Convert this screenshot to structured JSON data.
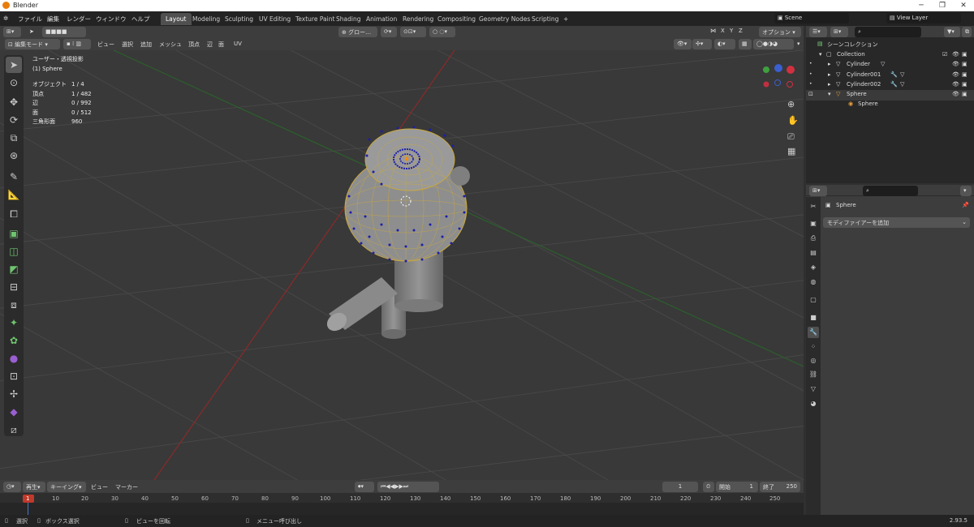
{
  "window": {
    "title": "Blender",
    "buttons": [
      "─",
      "❐",
      "✕"
    ]
  },
  "menu": {
    "items": [
      "ファイル",
      "編集",
      "レンダー",
      "ウィンドウ",
      "ヘルプ"
    ]
  },
  "workspaces": [
    "Layout",
    "Modeling",
    "Sculpting",
    "UV Editing",
    "Texture Paint",
    "Shading",
    "Animation",
    "Rendering",
    "Compositing",
    "Geometry Nodes",
    "Scripting",
    "+"
  ],
  "active_workspace": "Layout",
  "scene": {
    "name": "Scene",
    "view_layer": "View Layer"
  },
  "toolbar": {
    "transform_orientation": "グロー…",
    "options": "オプション"
  },
  "header3d": {
    "mode": "編集モード",
    "menus": [
      "ビュー",
      "選択",
      "追加",
      "メッシュ",
      "頂点",
      "辺",
      "面",
      "UV"
    ],
    "axes": [
      "X",
      "Y",
      "Z"
    ]
  },
  "viewport": {
    "view_name": "ユーザー・透視投影",
    "object_name": "(1) Sphere",
    "stats": [
      {
        "label": "オブジェクト",
        "value": "1 / 4"
      },
      {
        "label": "頂点",
        "value": "1 / 482"
      },
      {
        "label": "辺",
        "value": "0 / 992"
      },
      {
        "label": "面",
        "value": "0 / 512"
      },
      {
        "label": "三角形面",
        "value": "960"
      }
    ]
  },
  "outliner": {
    "root": "シーンコレクション",
    "collection": "Collection",
    "items": [
      "Cylinder",
      "Cylinder001",
      "Cylinder002",
      "Sphere"
    ],
    "child": "Sphere"
  },
  "properties": {
    "object": "Sphere",
    "add_modifier": "モディファイアーを追加"
  },
  "timeline": {
    "menus": [
      "再生",
      "キーイング",
      "ビュー",
      "マーカー"
    ],
    "current_frame": "1",
    "start_label": "開始",
    "start": "1",
    "end_label": "終了",
    "end": "250",
    "ticks": [
      "1",
      "10",
      "20",
      "30",
      "40",
      "50",
      "60",
      "70",
      "80",
      "90",
      "100",
      "110",
      "120",
      "130",
      "140",
      "150",
      "160",
      "170",
      "180",
      "190",
      "200",
      "210",
      "220",
      "230",
      "240",
      "250"
    ]
  },
  "status": {
    "select": "選択",
    "box_select": "ボックス選択",
    "rotate_view": "ビューを回転",
    "call_menu": "メニュー呼び出し",
    "version": "2.93.5"
  }
}
